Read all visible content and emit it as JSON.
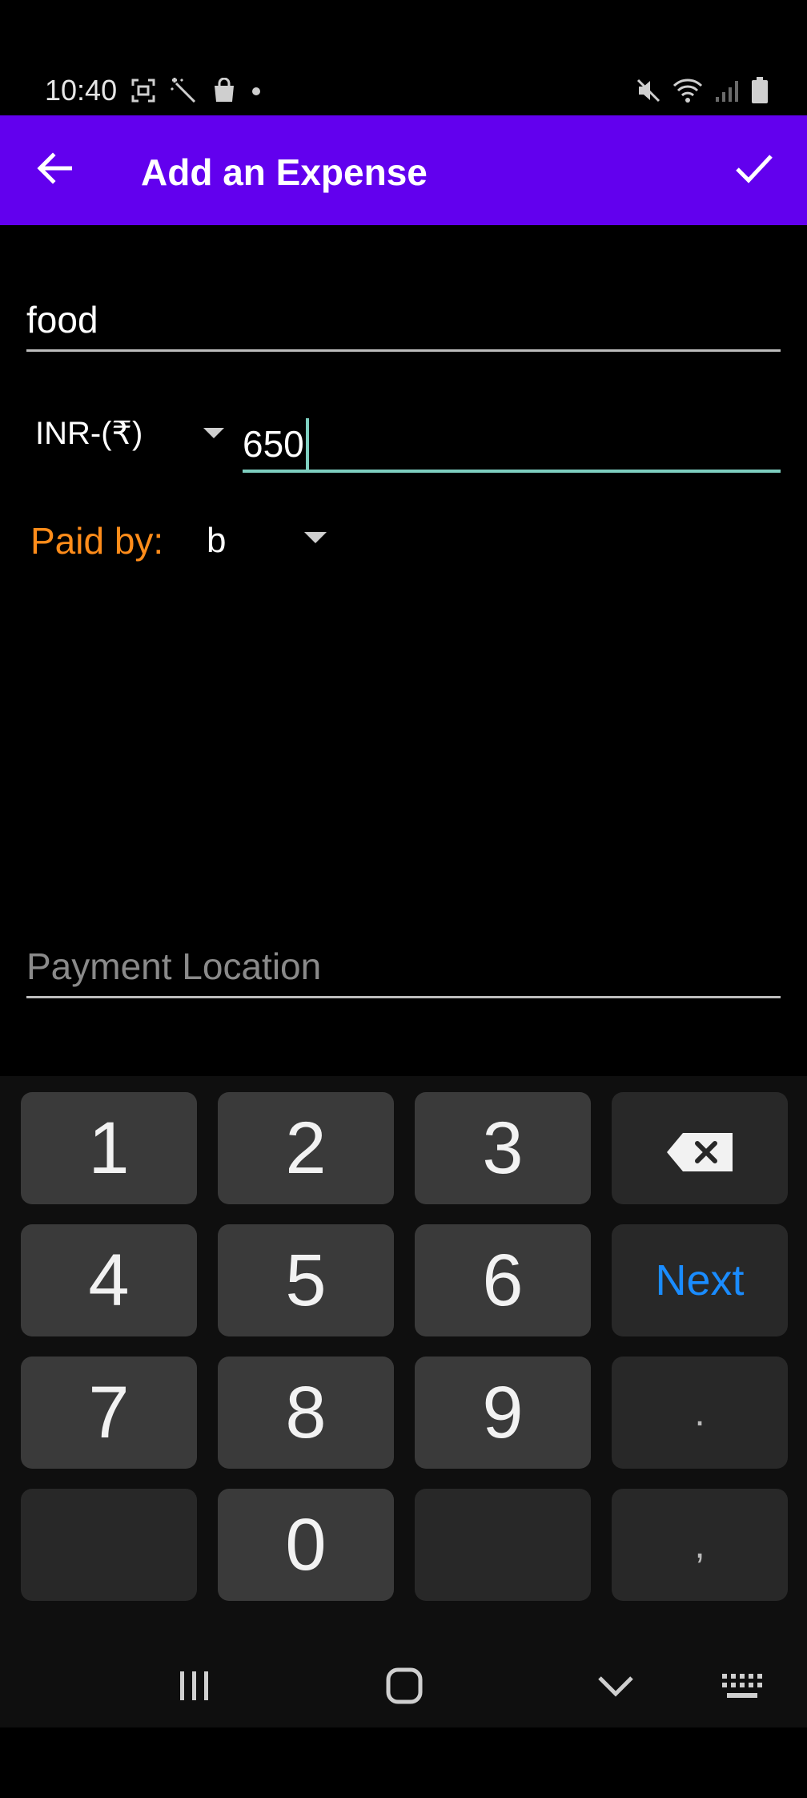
{
  "status_bar": {
    "time": "10:40",
    "left_icons": [
      "screenshot-icon",
      "magic-wand-icon",
      "shopping-bag-icon",
      "dot-icon"
    ],
    "right_icons": [
      "mute-icon",
      "wifi-icon",
      "signal-icon",
      "battery-icon"
    ]
  },
  "app_bar": {
    "title": "Add an Expense",
    "background": "#6200EE"
  },
  "form": {
    "description_value": "food",
    "currency_label": "INR-(₹)",
    "amount_value": "650",
    "paid_by_label": "Paid by:",
    "paid_by_value": "b",
    "location_placeholder": "Payment Location",
    "accent_color": "#7ECFC0",
    "label_color": "#FF8C1A"
  },
  "keyboard": {
    "rows": [
      [
        "1",
        "2",
        "3",
        "backspace"
      ],
      [
        "4",
        "5",
        "6",
        "Next"
      ],
      [
        "7",
        "8",
        "9",
        "."
      ],
      [
        "",
        "0",
        "",
        ","
      ]
    ],
    "next_label": "Next"
  },
  "nav_bar": {
    "items": [
      "recents-icon",
      "home-icon",
      "hide-keyboard-icon",
      "keyboard-icon"
    ]
  }
}
